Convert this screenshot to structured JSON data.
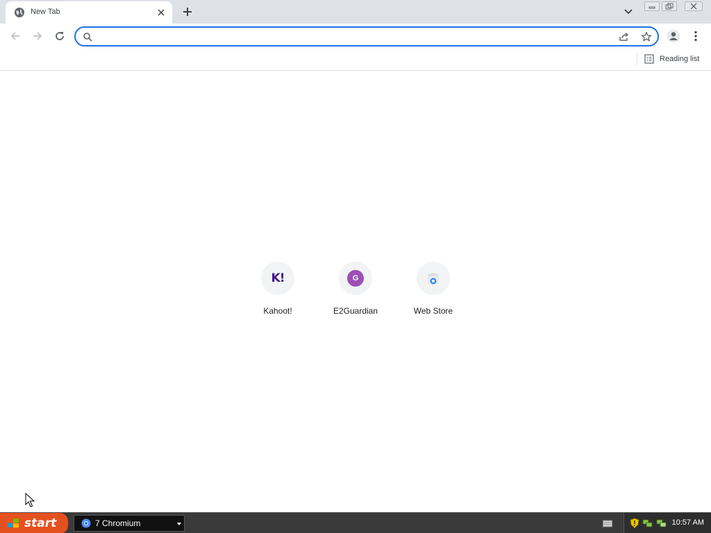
{
  "browser": {
    "tab": {
      "title": "New Tab",
      "favicon": "globe-icon"
    },
    "omnibox": {
      "value": "",
      "placeholder": ""
    },
    "bookmarks_bar": {
      "reading_list_label": "Reading list"
    },
    "colors": {
      "accent": "#1a73e8",
      "tabstrip": "#dee1e6"
    }
  },
  "shortcuts": [
    {
      "label": "Kahoot!",
      "icon": "kahoot-icon",
      "icon_text": "K!",
      "color": "#46178f"
    },
    {
      "label": "E2Guardian",
      "icon": "e2guardian-icon",
      "icon_text": "G",
      "color": "#9c4fb7"
    },
    {
      "label": "Web Store",
      "icon": "web-store-icon",
      "color": "#4285f4"
    }
  ],
  "taskbar": {
    "start_label": "start",
    "task_label": "7 Chromium",
    "clock": "10:57 AM"
  }
}
